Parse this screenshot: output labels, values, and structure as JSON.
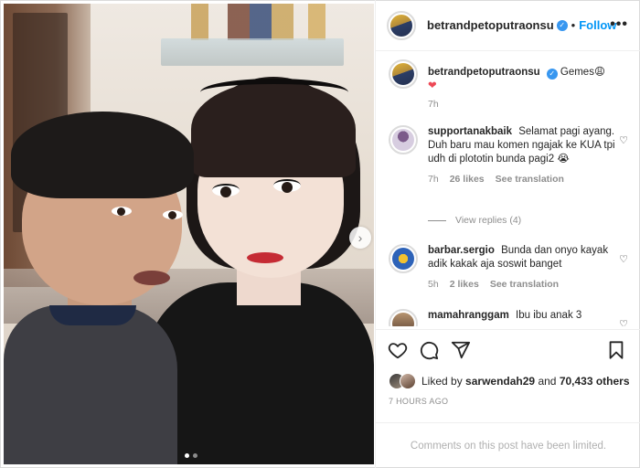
{
  "post": {
    "author": "betrandpetoputraonsu",
    "follow_label": "Follow",
    "separator": "•",
    "more_label": "•••",
    "caption": {
      "username": "betrandpetoputraonsu",
      "text": "Gemes😩",
      "heart": "❤",
      "time": "7h"
    }
  },
  "comments": [
    {
      "username": "supportanakbaik",
      "text": "Selamat pagi ayang. Duh baru mau komen ngajak ke KUA tpi udh di plototin bunda pagi2 😭",
      "time": "7h",
      "likes": "26 likes",
      "see_translation": "See translation"
    },
    {
      "username": "barbar.sergio",
      "text": "Bunda dan onyo kayak adik kakak aja soswit banget",
      "time": "5h",
      "likes": "2 likes",
      "see_translation": "See translation"
    },
    {
      "username": "mamahranggam",
      "text": "Ibu ibu anak 3"
    }
  ],
  "view_replies": "View replies (4)",
  "likes": {
    "prefix": "Liked by",
    "user": "sarwendah29",
    "suffix": "and",
    "others": "70,433 others"
  },
  "time_ago": "7 HOURS AGO",
  "comments_limited": "Comments on this post have been limited.",
  "carousel": {
    "slides": 2,
    "current": 1
  },
  "icons": {
    "next": "chevron-right-icon",
    "like": "heart-icon",
    "comment": "comment-icon",
    "share": "paper-plane-icon",
    "save": "bookmark-icon",
    "verified": "verified-badge-icon"
  },
  "colors": {
    "link": "#0095f6",
    "verified": "#3897f0",
    "muted": "#8e8e8e",
    "border": "#efefef"
  }
}
